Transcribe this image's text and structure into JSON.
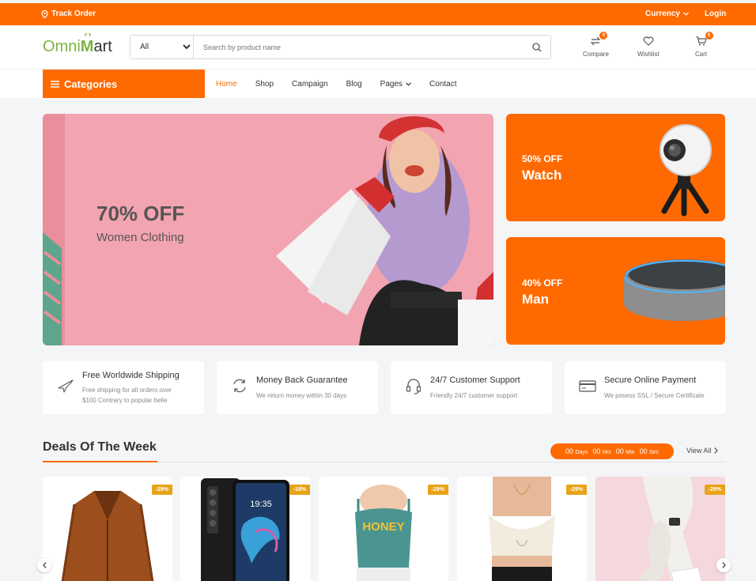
{
  "topbar": {
    "track_order": "Track Order",
    "currency": "Currency",
    "login": "Login"
  },
  "header": {
    "logo_prefix": "Omni",
    "logo_m": "M",
    "logo_suffix": "art",
    "category_select": "All",
    "search_placeholder": "Search by product name",
    "compare": {
      "label": "Compare",
      "count": "0"
    },
    "wishlist": {
      "label": "Wishlist"
    },
    "cart": {
      "label": "Cart",
      "count": "0"
    }
  },
  "nav": {
    "categories_label": "Categories",
    "items": [
      "Home",
      "Shop",
      "Campaign",
      "Blog",
      "Pages",
      "Contact"
    ]
  },
  "hero": {
    "discount": "70% OFF",
    "subtitle": "Women Clothing"
  },
  "promos": [
    {
      "off": "50% OFF",
      "name": "Watch"
    },
    {
      "off": "40% OFF",
      "name": "Man"
    }
  ],
  "features": [
    {
      "title": "Free Worldwide Shipping",
      "desc1": "Free shipping for all orders over",
      "desc2": "$100 Contrary to popular belie"
    },
    {
      "title": "Money Back Guarantee",
      "desc1": "We return money within 30 days"
    },
    {
      "title": "24/7 Customer Support",
      "desc1": "Friendly 24/7 customer support"
    },
    {
      "title": "Secure Online Payment",
      "desc1": "We posess SSL / Secure Certificate"
    }
  ],
  "deals": {
    "title": "Deals Of The Week",
    "timer": {
      "days": "00",
      "days_lbl": "Days",
      "hrs": "00",
      "hrs_lbl": "Hrs",
      "min": "00",
      "min_lbl": "Min",
      "sec": "00",
      "sec_lbl": "Sec"
    },
    "view_all": "View All",
    "products": [
      {
        "discount": "-29%"
      },
      {
        "discount": "-18%",
        "phone_time": "19:35"
      },
      {
        "discount": "-29%",
        "print": "HONEY"
      },
      {
        "discount": "-29%"
      },
      {
        "discount": "-29%"
      }
    ]
  },
  "colors": {
    "accent": "#ff6a00",
    "badge": "#e8a317",
    "logo_green": "#7cb342"
  }
}
